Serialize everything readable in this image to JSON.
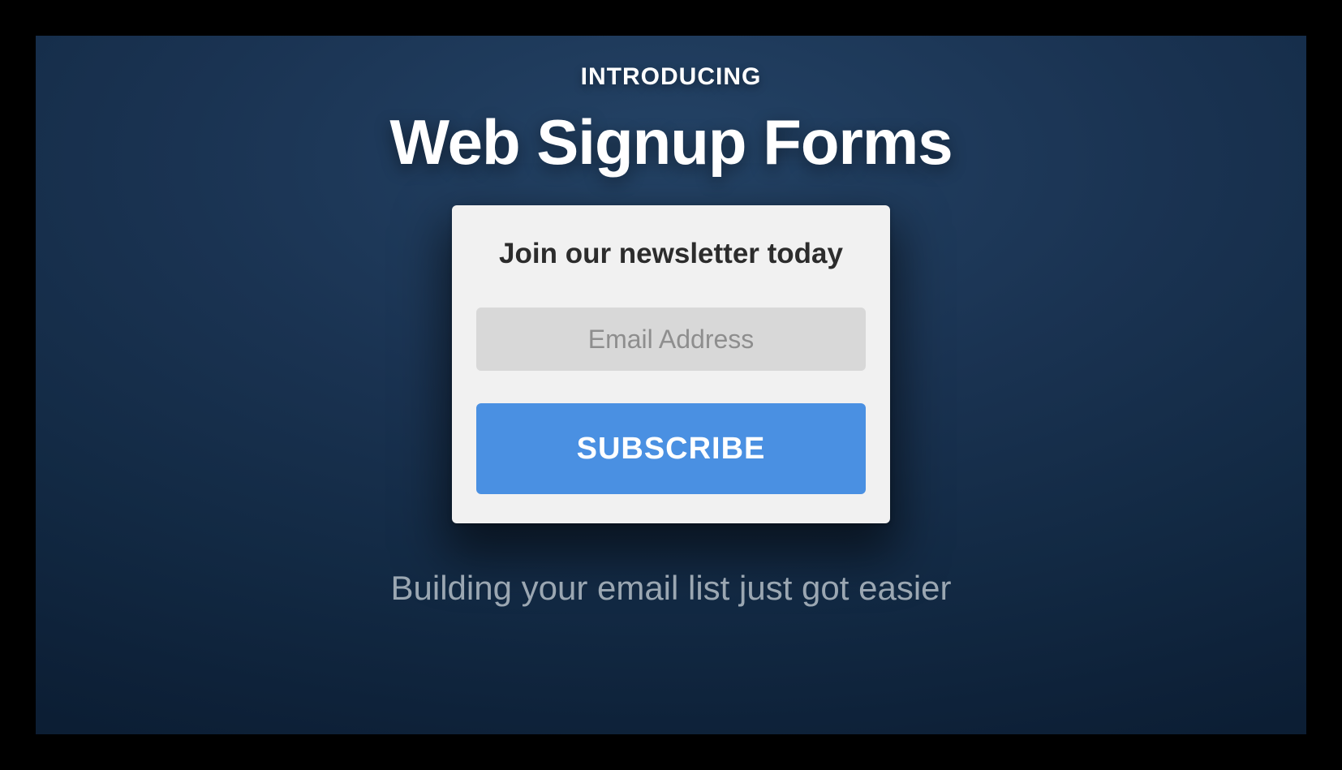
{
  "hero": {
    "eyebrow": "INTRODUCING",
    "headline": "Web Signup Forms",
    "tagline": "Building your email list just got easier"
  },
  "card": {
    "title": "Join our newsletter today",
    "email_placeholder": "Email Address",
    "email_value": "",
    "subscribe_label": "SUBSCRIBE"
  },
  "colors": {
    "accent": "#4a90e2",
    "panel_bg": "#153453",
    "card_bg": "#f1f1f1",
    "input_bg": "#d8d8d8"
  }
}
